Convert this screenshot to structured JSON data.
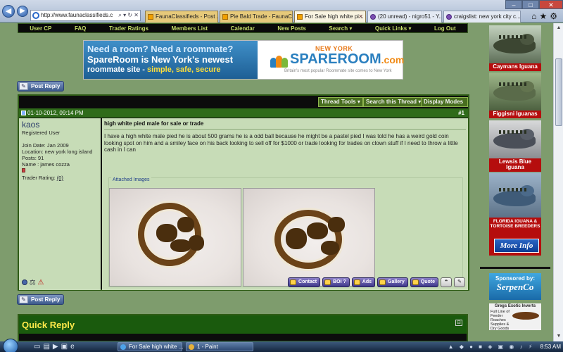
{
  "browser": {
    "url": "http://www.faunaclassifieds.c",
    "tabs": [
      {
        "label": "FaunaClassifieds - Post ...",
        "active": false
      },
      {
        "label": "Pie Bald Trade - FaunaCl...",
        "active": false
      },
      {
        "label": "For Sale high white pi...",
        "active": true
      },
      {
        "label": "(20 unread) - nigro51 - Y...",
        "active": false
      },
      {
        "label": "craigslist: new york city c...",
        "active": false
      }
    ]
  },
  "navbar": {
    "items": [
      "User CP",
      "FAQ",
      "Trader Ratings",
      "Members List",
      "Calendar",
      "New Posts",
      "Search ▾",
      "Quick Links ▾",
      "Log Out"
    ]
  },
  "ad": {
    "line1": "Need a room? Need a roommate?",
    "line2": "SpareRoom is New York's newest",
    "line3_a": "roommate site - ",
    "line3_b": "simple, safe, secure",
    "city": "NEW YORK",
    "brand": "SPAREROOM",
    "brand_suffix": ".com",
    "tagline": "Britain's most popular Roommate site comes to New York"
  },
  "buttons": {
    "post_reply": "Post Reply"
  },
  "thread_tools": [
    "Thread Tools ▾",
    "Search this Thread ▾",
    "Display Modes ▾"
  ],
  "post": {
    "date": "01-10-2012, 09:14 PM",
    "number": "#1",
    "title": "high white pied male for sale or trade",
    "body": "I have a high white male pied he is about 500 grams he is a odd ball because he might be a pastel pied I was told he has a weird gold coin looking spot on him and a smiley face on his back looking to sell off for $1000 or trade looking for trades on clown stuff if I need to throw a little cash in I can",
    "attached_label": "Attached Images",
    "user": {
      "name": "kaos",
      "title": "Registered User",
      "join_date": "Join Date: Jan 2009",
      "location": "Location: new york long island",
      "posts": "Posts: 91",
      "real_name": "Name : james cozza",
      "trader_rating_label": "Trader Rating: ",
      "trader_rating_value": "(0)"
    },
    "actions": [
      "Contact",
      "BOI ?",
      "Ads",
      "Gallery",
      "Quote"
    ]
  },
  "quick_reply": {
    "title": "Quick Reply"
  },
  "sidebar": {
    "cards": [
      {
        "label": "Caymans Iguana"
      },
      {
        "label": "Figgisni Iguanas"
      },
      {
        "label": "Lewsis Blue Iguana"
      },
      {
        "label": "FLORIDA IGUANA & TORTOISE BREEDERS"
      }
    ],
    "more_info": "More Info",
    "sponsored_by": "Sponsored by:",
    "sponsor_name": "SerpenCo",
    "gregs_title": "Gregs Exotic Inverts",
    "gregs_text": "Full Line of Feeder Roaches Supplies & Dry Goods"
  },
  "taskbar": {
    "items": [
      "For Sale high white ...",
      "1 - Paint"
    ],
    "clock": "8:53 AM"
  }
}
